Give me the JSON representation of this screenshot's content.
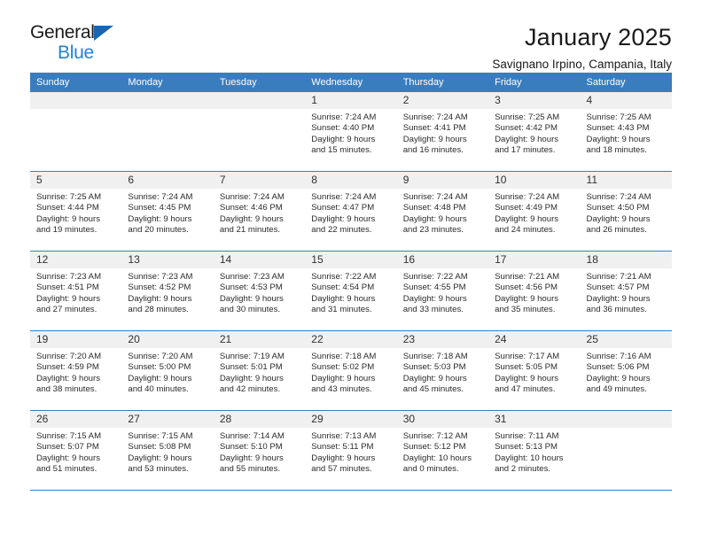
{
  "brand": {
    "line1": "General",
    "line2": "Blue",
    "triangle_icon": "triangle-icon",
    "accent_color": "#1567b5",
    "accent_color_light": "#1f82d6"
  },
  "header": {
    "title": "January 2025",
    "subtitle": "Savignano Irpino, Campania, Italy"
  },
  "theme": {
    "header_bg": "#3a7dbf",
    "daynum_bg": "#f0f0f0",
    "text": "#2b2b2b"
  },
  "calendar": {
    "weekday_headers": [
      "Sunday",
      "Monday",
      "Tuesday",
      "Wednesday",
      "Thursday",
      "Friday",
      "Saturday"
    ],
    "weeks": [
      [
        {
          "day": "",
          "lines": []
        },
        {
          "day": "",
          "lines": []
        },
        {
          "day": "",
          "lines": []
        },
        {
          "day": "1",
          "lines": [
            "Sunrise: 7:24 AM",
            "Sunset: 4:40 PM",
            "Daylight: 9 hours",
            "and 15 minutes."
          ]
        },
        {
          "day": "2",
          "lines": [
            "Sunrise: 7:24 AM",
            "Sunset: 4:41 PM",
            "Daylight: 9 hours",
            "and 16 minutes."
          ]
        },
        {
          "day": "3",
          "lines": [
            "Sunrise: 7:25 AM",
            "Sunset: 4:42 PM",
            "Daylight: 9 hours",
            "and 17 minutes."
          ]
        },
        {
          "day": "4",
          "lines": [
            "Sunrise: 7:25 AM",
            "Sunset: 4:43 PM",
            "Daylight: 9 hours",
            "and 18 minutes."
          ]
        }
      ],
      [
        {
          "day": "5",
          "lines": [
            "Sunrise: 7:25 AM",
            "Sunset: 4:44 PM",
            "Daylight: 9 hours",
            "and 19 minutes."
          ]
        },
        {
          "day": "6",
          "lines": [
            "Sunrise: 7:24 AM",
            "Sunset: 4:45 PM",
            "Daylight: 9 hours",
            "and 20 minutes."
          ]
        },
        {
          "day": "7",
          "lines": [
            "Sunrise: 7:24 AM",
            "Sunset: 4:46 PM",
            "Daylight: 9 hours",
            "and 21 minutes."
          ]
        },
        {
          "day": "8",
          "lines": [
            "Sunrise: 7:24 AM",
            "Sunset: 4:47 PM",
            "Daylight: 9 hours",
            "and 22 minutes."
          ]
        },
        {
          "day": "9",
          "lines": [
            "Sunrise: 7:24 AM",
            "Sunset: 4:48 PM",
            "Daylight: 9 hours",
            "and 23 minutes."
          ]
        },
        {
          "day": "10",
          "lines": [
            "Sunrise: 7:24 AM",
            "Sunset: 4:49 PM",
            "Daylight: 9 hours",
            "and 24 minutes."
          ]
        },
        {
          "day": "11",
          "lines": [
            "Sunrise: 7:24 AM",
            "Sunset: 4:50 PM",
            "Daylight: 9 hours",
            "and 26 minutes."
          ]
        }
      ],
      [
        {
          "day": "12",
          "lines": [
            "Sunrise: 7:23 AM",
            "Sunset: 4:51 PM",
            "Daylight: 9 hours",
            "and 27 minutes."
          ]
        },
        {
          "day": "13",
          "lines": [
            "Sunrise: 7:23 AM",
            "Sunset: 4:52 PM",
            "Daylight: 9 hours",
            "and 28 minutes."
          ]
        },
        {
          "day": "14",
          "lines": [
            "Sunrise: 7:23 AM",
            "Sunset: 4:53 PM",
            "Daylight: 9 hours",
            "and 30 minutes."
          ]
        },
        {
          "day": "15",
          "lines": [
            "Sunrise: 7:22 AM",
            "Sunset: 4:54 PM",
            "Daylight: 9 hours",
            "and 31 minutes."
          ]
        },
        {
          "day": "16",
          "lines": [
            "Sunrise: 7:22 AM",
            "Sunset: 4:55 PM",
            "Daylight: 9 hours",
            "and 33 minutes."
          ]
        },
        {
          "day": "17",
          "lines": [
            "Sunrise: 7:21 AM",
            "Sunset: 4:56 PM",
            "Daylight: 9 hours",
            "and 35 minutes."
          ]
        },
        {
          "day": "18",
          "lines": [
            "Sunrise: 7:21 AM",
            "Sunset: 4:57 PM",
            "Daylight: 9 hours",
            "and 36 minutes."
          ]
        }
      ],
      [
        {
          "day": "19",
          "lines": [
            "Sunrise: 7:20 AM",
            "Sunset: 4:59 PM",
            "Daylight: 9 hours",
            "and 38 minutes."
          ]
        },
        {
          "day": "20",
          "lines": [
            "Sunrise: 7:20 AM",
            "Sunset: 5:00 PM",
            "Daylight: 9 hours",
            "and 40 minutes."
          ]
        },
        {
          "day": "21",
          "lines": [
            "Sunrise: 7:19 AM",
            "Sunset: 5:01 PM",
            "Daylight: 9 hours",
            "and 42 minutes."
          ]
        },
        {
          "day": "22",
          "lines": [
            "Sunrise: 7:18 AM",
            "Sunset: 5:02 PM",
            "Daylight: 9 hours",
            "and 43 minutes."
          ]
        },
        {
          "day": "23",
          "lines": [
            "Sunrise: 7:18 AM",
            "Sunset: 5:03 PM",
            "Daylight: 9 hours",
            "and 45 minutes."
          ]
        },
        {
          "day": "24",
          "lines": [
            "Sunrise: 7:17 AM",
            "Sunset: 5:05 PM",
            "Daylight: 9 hours",
            "and 47 minutes."
          ]
        },
        {
          "day": "25",
          "lines": [
            "Sunrise: 7:16 AM",
            "Sunset: 5:06 PM",
            "Daylight: 9 hours",
            "and 49 minutes."
          ]
        }
      ],
      [
        {
          "day": "26",
          "lines": [
            "Sunrise: 7:15 AM",
            "Sunset: 5:07 PM",
            "Daylight: 9 hours",
            "and 51 minutes."
          ]
        },
        {
          "day": "27",
          "lines": [
            "Sunrise: 7:15 AM",
            "Sunset: 5:08 PM",
            "Daylight: 9 hours",
            "and 53 minutes."
          ]
        },
        {
          "day": "28",
          "lines": [
            "Sunrise: 7:14 AM",
            "Sunset: 5:10 PM",
            "Daylight: 9 hours",
            "and 55 minutes."
          ]
        },
        {
          "day": "29",
          "lines": [
            "Sunrise: 7:13 AM",
            "Sunset: 5:11 PM",
            "Daylight: 9 hours",
            "and 57 minutes."
          ]
        },
        {
          "day": "30",
          "lines": [
            "Sunrise: 7:12 AM",
            "Sunset: 5:12 PM",
            "Daylight: 10 hours",
            "and 0 minutes."
          ]
        },
        {
          "day": "31",
          "lines": [
            "Sunrise: 7:11 AM",
            "Sunset: 5:13 PM",
            "Daylight: 10 hours",
            "and 2 minutes."
          ]
        },
        {
          "day": "",
          "lines": []
        }
      ]
    ]
  }
}
